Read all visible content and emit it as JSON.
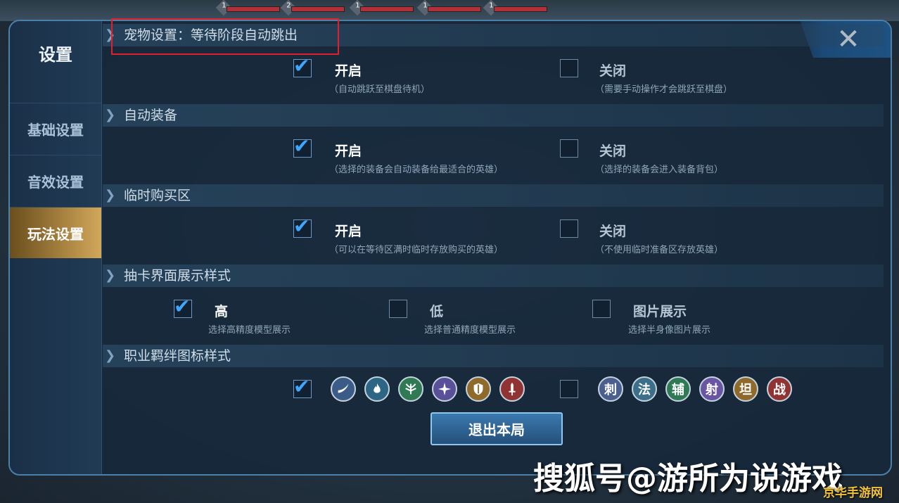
{
  "background": {
    "hp_levels": [
      "1",
      "2",
      "1",
      "1",
      "1"
    ]
  },
  "sidebar": {
    "title": "设置",
    "tabs": [
      {
        "label": "基础设置",
        "active": false
      },
      {
        "label": "音效设置",
        "active": false
      },
      {
        "label": "玩法设置",
        "active": true
      }
    ]
  },
  "close_symbol": "✕",
  "sections": {
    "pet": {
      "title": "宠物设置：等待阶段自动跳出",
      "on_label": "开启",
      "on_desc": "（自动跳跃至棋盘待机）",
      "on_checked": true,
      "off_label": "关闭",
      "off_desc": "（需要手动操作才会跳跃至棋盘）",
      "off_checked": false
    },
    "equip": {
      "title": "自动装备",
      "on_label": "开启",
      "on_desc": "（选择的装备会自动装备给最适合的英雄）",
      "on_checked": true,
      "off_label": "关闭",
      "off_desc": "（选择的装备会进入装备背包）",
      "off_checked": false
    },
    "temp": {
      "title": "临时购买区",
      "on_label": "开启",
      "on_desc": "（可以在等待区满时临时存放购买的英雄）",
      "on_checked": true,
      "off_label": "关闭",
      "off_desc": "（不使用临时准备区存放英雄）",
      "off_checked": false
    },
    "draw": {
      "title": "抽卡界面展示样式",
      "options": [
        {
          "label": "高",
          "desc": "选择高精度模型展示",
          "checked": true
        },
        {
          "label": "低",
          "desc": "选择普通精度模型展示",
          "checked": false
        },
        {
          "label": "图片展示",
          "desc": "选择半身像图片展示",
          "checked": false
        }
      ]
    },
    "icon_style": {
      "title": "职业羁绊图标样式",
      "graphic_checked": true,
      "graphic_icons": [
        "assassin-blade-icon",
        "mage-flame-icon",
        "support-leaf-icon",
        "marksman-crosshair-icon",
        "tank-shield-icon",
        "warrior-sword-icon"
      ],
      "text_checked": false,
      "text_icons": [
        {
          "char": "刺",
          "color": "#4a5f8e"
        },
        {
          "char": "法",
          "color": "#3c6f8a"
        },
        {
          "char": "辅",
          "color": "#2f7a55"
        },
        {
          "char": "射",
          "color": "#6a55a3"
        },
        {
          "char": "坦",
          "color": "#8f6a2a"
        },
        {
          "char": "战",
          "color": "#913333"
        }
      ]
    }
  },
  "exit_button": "退出本局",
  "watermark": "搜狐号@游所为说游戏",
  "watermark_small": "京华手游网",
  "colors": {
    "check": "#3fa7ff",
    "active_tab": "#d2a75a",
    "highlight": "#e0202a"
  }
}
